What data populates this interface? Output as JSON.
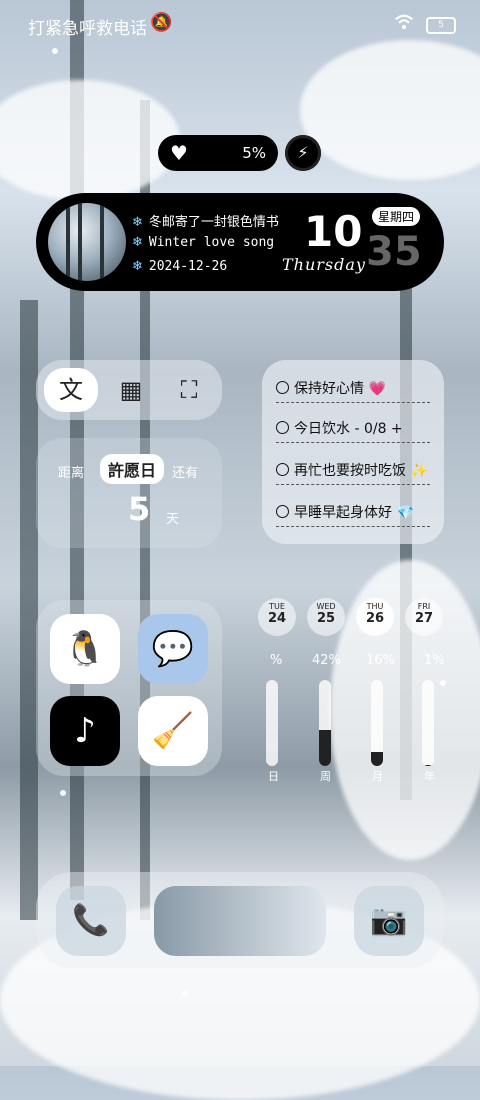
{
  "status_bar": {
    "carrier_text": "打紧急呼救电话",
    "bell_icon": "bell-off-icon",
    "wifi_icon": "wifi-icon",
    "battery_text": "5"
  },
  "battery_pill": {
    "icon": "heart-icon",
    "percent": "5%"
  },
  "charging_icon": "lightning-icon",
  "music_widget": {
    "line1": "冬邮寄了一封银色情书",
    "line2": "Winter love song",
    "line3": "2024-12-26",
    "hour": "10",
    "minute": "35",
    "weekday": "星期四",
    "day_name": "Thursday"
  },
  "tools": [
    {
      "name": "translate-icon",
      "glyph": "文"
    },
    {
      "name": "qr-code-icon",
      "glyph": "▦"
    },
    {
      "name": "scan-icon",
      "glyph": "⛶"
    }
  ],
  "countdown": {
    "left_label": "距离",
    "event_name": "許愿日",
    "right_label": "还有",
    "days": "5",
    "unit": "天"
  },
  "todo": {
    "items": [
      {
        "text": "保持好心情",
        "emoji": "💗"
      },
      {
        "text": "今日饮水 -  0/8  +",
        "emoji": ""
      },
      {
        "text": "再忙也要按时吃饭",
        "emoji": "✨"
      },
      {
        "text": "早睡早起身体好",
        "emoji": "💎"
      }
    ]
  },
  "apps": [
    {
      "name": "qq-app",
      "glyph": "🐧",
      "bg": "#ffffff"
    },
    {
      "name": "wechat-app",
      "glyph": "💬",
      "bg": "#a9c7ea"
    },
    {
      "name": "tiktok-app",
      "glyph": "♪",
      "bg": "#000000"
    },
    {
      "name": "cleaner-app",
      "glyph": "🧹",
      "bg": "#ffffff"
    }
  ],
  "calendar": {
    "days": [
      {
        "wd": "TUE",
        "dn": "24"
      },
      {
        "wd": "WED",
        "dn": "25"
      },
      {
        "wd": "THU",
        "dn": "26",
        "current": true
      },
      {
        "wd": "FRI",
        "dn": "27"
      }
    ],
    "stats": [
      {
        "pct": "%",
        "label": "日",
        "fill": 0.0
      },
      {
        "pct": "42%",
        "label": "周",
        "fill": 0.42
      },
      {
        "pct": "16%",
        "label": "月",
        "fill": 0.16
      },
      {
        "pct": "1%",
        "label": "年",
        "fill": 0.01
      }
    ]
  },
  "dock": [
    {
      "name": "phone-icon",
      "glyph": "📞"
    },
    {
      "name": "photo-widget",
      "glyph": ""
    },
    {
      "name": "camera-icon",
      "glyph": "📷"
    }
  ]
}
